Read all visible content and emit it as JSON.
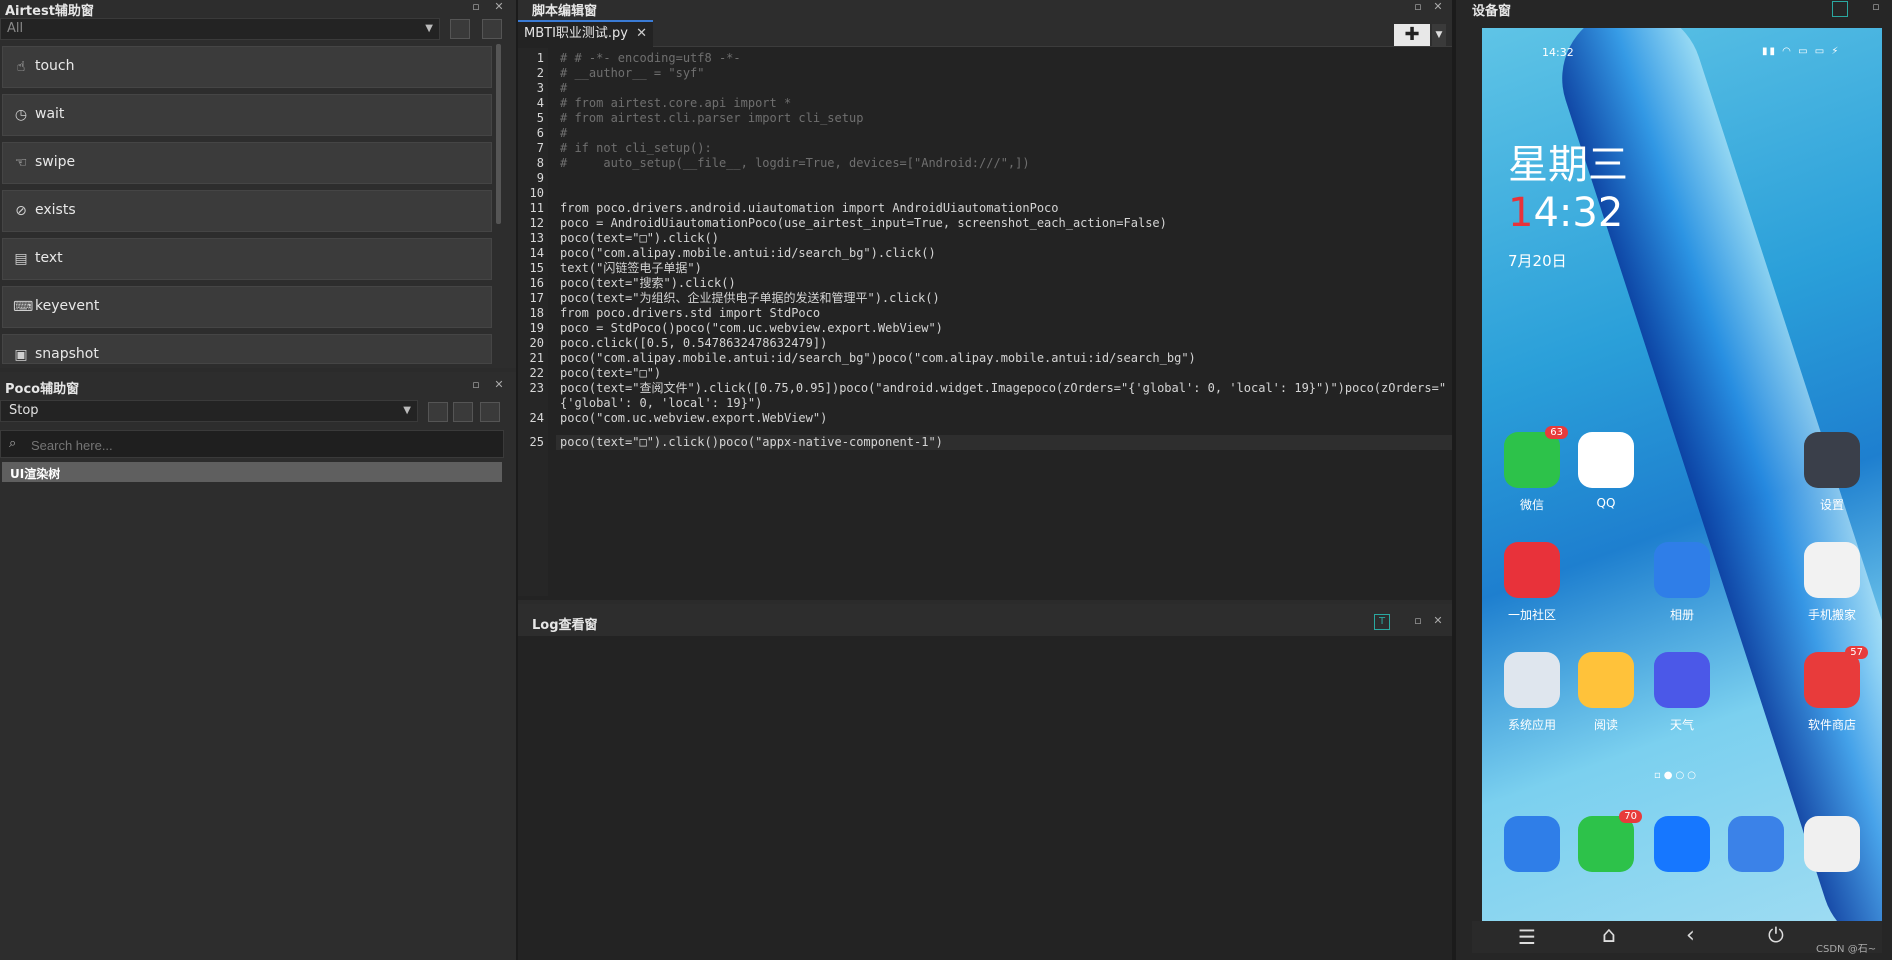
{
  "airtest_panel": {
    "title": "Airtest辅助窗",
    "filter_value": "All",
    "items": [
      {
        "label": "touch",
        "icon": "touch-icon"
      },
      {
        "label": "wait",
        "icon": "clock-icon"
      },
      {
        "label": "swipe",
        "icon": "swipe-icon"
      },
      {
        "label": "exists",
        "icon": "search-icon"
      },
      {
        "label": "text",
        "icon": "text-icon"
      },
      {
        "label": "keyevent",
        "icon": "keyboard-icon"
      },
      {
        "label": "snapshot",
        "icon": "camera-icon"
      }
    ]
  },
  "poco_panel": {
    "title": "Poco辅助窗",
    "mode_value": "Stop",
    "search_placeholder": "Search here...",
    "tree_root": "UI渲染树"
  },
  "editor": {
    "title": "脚本编辑窗",
    "tab_label": "MBTI职业测试.py",
    "line_numbers": [
      "1",
      "2",
      "3",
      "4",
      "5",
      "6",
      "7",
      "8",
      "9",
      "10",
      "11",
      "12",
      "13",
      "14",
      "15",
      "16",
      "17",
      "18",
      "19",
      "20",
      "21",
      "22",
      "23",
      "",
      "24",
      "25"
    ],
    "lines": [
      "# # -*- encoding=utf8 -*-",
      "# __author__ = \"syf\"",
      "#",
      "# from airtest.core.api import *",
      "# from airtest.cli.parser import cli_setup",
      "#",
      "# if not cli_setup():",
      "#     auto_setup(__file__, logdir=True, devices=[\"Android:///\",])",
      "",
      "",
      "from poco.drivers.android.uiautomation import AndroidUiautomationPoco",
      "poco = AndroidUiautomationPoco(use_airtest_input=True, screenshot_each_action=False)",
      "poco(text=\"□\").click()",
      "poco(\"com.alipay.mobile.antui:id/search_bg\").click()",
      "text(\"闪链签电子单据\")",
      "poco(text=\"搜索\").click()",
      "poco(text=\"为组织、企业提供电子单据的发送和管理平\").click()",
      "from poco.drivers.std import StdPoco",
      "poco = StdPoco()poco(\"com.uc.webview.export.WebView\")",
      "poco.click([0.5, 0.5478632478632479])",
      "poco(\"com.alipay.mobile.antui:id/search_bg\")poco(\"com.alipay.mobile.antui:id/search_bg\")",
      "poco(text=\"□\")",
      "poco(text=\"查阅文件\").click([0.75,0.95])poco(\"android.widget.Imagepoco(zOrders=\"{'global': 0, 'local': 19}\")\")poco(zOrders=\"",
      "{'global': 0, 'local': 19}\")",
      "poco(\"com.uc.webview.export.WebView\")",
      "poco(text=\"□\").click()poco(\"appx-native-component-1\")"
    ]
  },
  "log_panel": {
    "title": "Log查看窗"
  },
  "device_panel": {
    "title": "设备窗",
    "status_time": "14:32",
    "weekday": "星期三",
    "clock_first_digit": "1",
    "clock_rest": "4:32",
    "date": "7月20日",
    "apps_row1": [
      {
        "label": "微信",
        "badge": "63",
        "color": "#2dc24a"
      },
      {
        "label": "QQ",
        "badge": "",
        "color": "#ffffff"
      },
      {
        "label": "设置",
        "badge": "",
        "color": "#3a3f4a"
      }
    ],
    "apps_row2": [
      {
        "label": "一加社区",
        "badge": "",
        "color": "#e8323a"
      },
      {
        "label": "相册",
        "badge": "",
        "color": "#2f7ee8"
      },
      {
        "label": "手机搬家",
        "badge": "",
        "color": "#f2f2f2"
      }
    ],
    "apps_row3": [
      {
        "label": "系统应用",
        "badge": "",
        "color": "#dfe6ee"
      },
      {
        "label": "阅读",
        "badge": "",
        "color": "#ffc23a"
      },
      {
        "label": "天气",
        "badge": "",
        "color": "#4b58e8"
      },
      {
        "label": "软件商店",
        "badge": "57",
        "color": "#e83b3b"
      }
    ],
    "dock_badge_messages": "70",
    "watermark": "CSDN @石~"
  }
}
